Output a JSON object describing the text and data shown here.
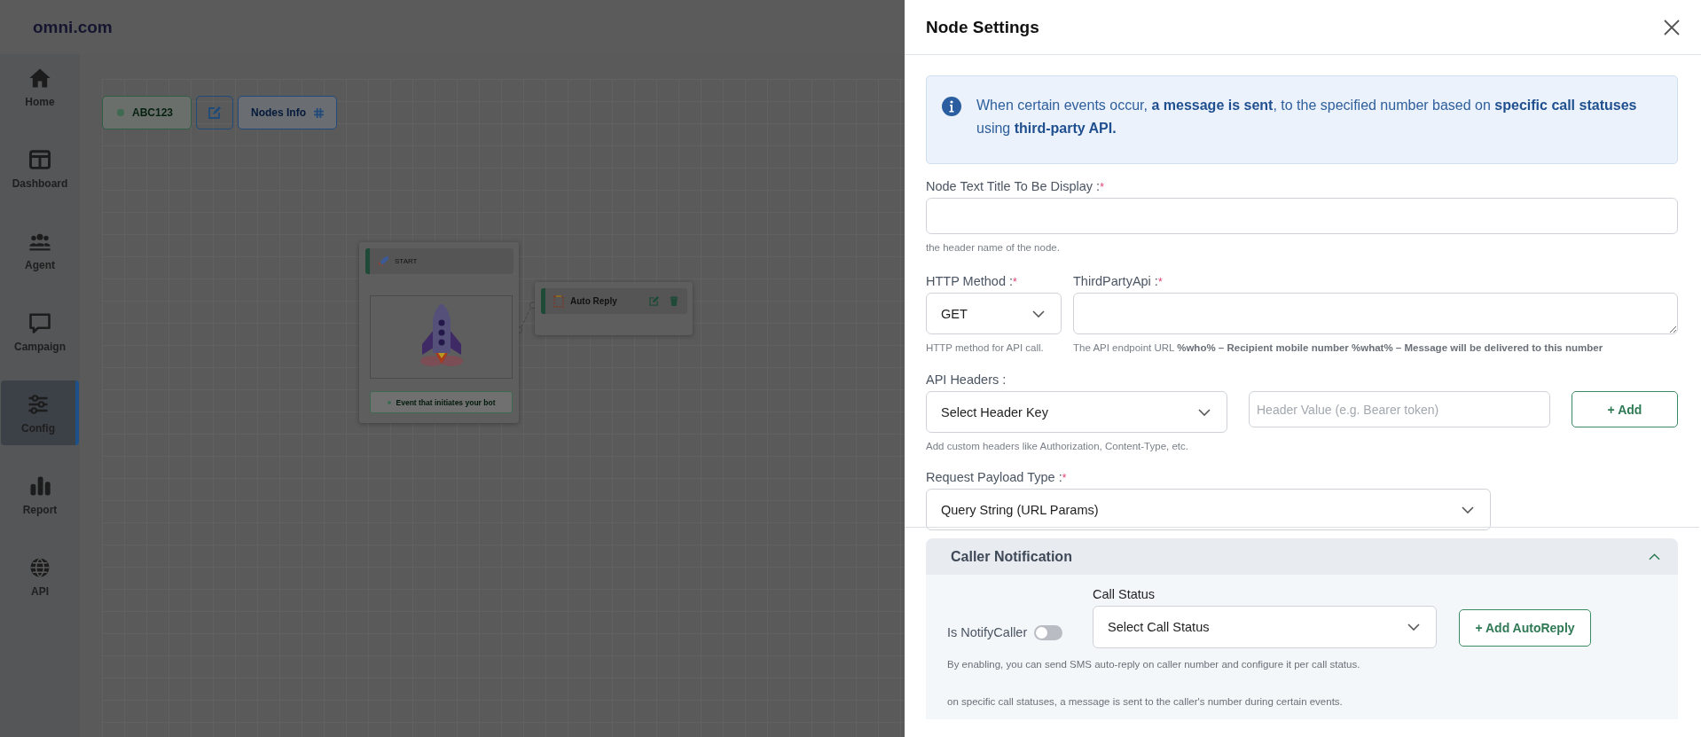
{
  "app": {
    "logo": "omni.com",
    "nav": [
      {
        "label": "Home",
        "selected": false
      },
      {
        "label": "Dashboard",
        "selected": false
      },
      {
        "label": "Agent",
        "selected": false
      },
      {
        "label": "Campaign",
        "selected": false
      },
      {
        "label": "Config",
        "selected": true
      },
      {
        "label": "Report",
        "selected": false
      },
      {
        "label": "API",
        "selected": false
      }
    ],
    "toolbar": {
      "flow_name": "ABC123",
      "nodes_info": "Nodes Info"
    },
    "nodes": [
      {
        "kind": "start",
        "title": "START",
        "caption": "Event that initiates your bot"
      },
      {
        "kind": "action",
        "title": "Auto Reply"
      }
    ]
  },
  "panel": {
    "title": "Node Settings",
    "info": "When certain events occur, **a message is sent**, to the specified number based on **specific call statuses** using **third-party API.**",
    "node_title": {
      "label": "Node Text Title To Be Display :",
      "required_mark": "*",
      "hint": "the header name of the node."
    },
    "http_method": {
      "label": "HTTP Method :",
      "required_mark": "*",
      "value": "GET",
      "hint": "HTTP method for API call."
    },
    "third_party_api": {
      "label": "ThirdPartyApi :",
      "required_mark": "*",
      "hint": "The API endpoint URL **%who% – Recipient mobile number %what% – Message will be delivered to this number**"
    },
    "api_headers": {
      "label": "API Headers :",
      "key_value": "Select Header Key",
      "value_placeholder": "Header Value (e.g. Bearer token)",
      "add_button": "+ Add",
      "hint": "Add custom headers like Authorization, Content-Type, etc."
    },
    "payload_type": {
      "label": "Request Payload Type :",
      "required_mark": "*",
      "value": "Query String (URL Params)"
    },
    "caller_notification": {
      "title": "Caller Notification",
      "expanded": true,
      "notify_label": "Is NotifyCaller",
      "notify_on": false,
      "call_status_label": "Call Status",
      "call_status_value": "Select Call Status",
      "add_button": "+ Add AutoReply",
      "notes": [
        "By enabling, you can send SMS auto-reply on caller number and configure it per call status.",
        "on specific call statuses, a message is sent to the caller's number during certain events."
      ]
    }
  }
}
